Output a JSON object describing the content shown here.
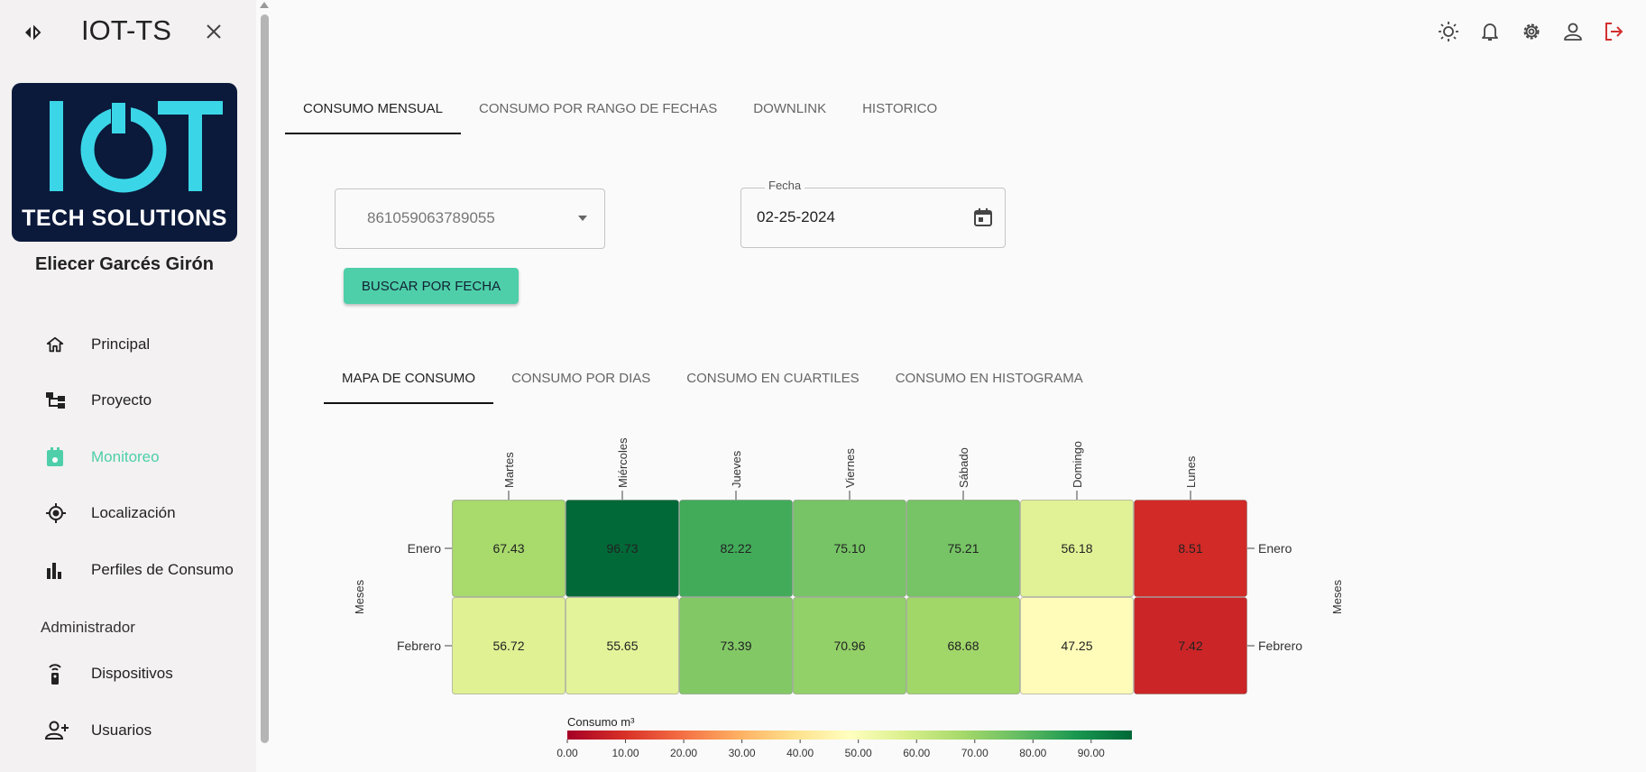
{
  "app": {
    "title": "IOT-TS"
  },
  "logo": {
    "tagline": "TECH SOLUTIONS"
  },
  "user": {
    "name": "Eliecer Garcés Girón"
  },
  "sidebar": {
    "items": [
      {
        "label": "Principal",
        "icon": "home-icon"
      },
      {
        "label": "Proyecto",
        "icon": "project-tree-icon"
      },
      {
        "label": "Monitoreo",
        "icon": "monitor-calendar-icon",
        "active": true
      },
      {
        "label": "Localización",
        "icon": "location-target-icon"
      },
      {
        "label": "Perfiles de Consumo",
        "icon": "bar-chart-icon"
      }
    ],
    "section_label": "Administrador",
    "admin_items": [
      {
        "label": "Dispositivos",
        "icon": "remote-device-icon"
      },
      {
        "label": "Usuarios",
        "icon": "add-user-icon"
      }
    ]
  },
  "topbar": {
    "icons": [
      "theme-sun-icon",
      "notifications-bell-icon",
      "settings-gear-icon",
      "account-person-icon",
      "logout-icon"
    ],
    "logout_color": "#d32f2f"
  },
  "main_tabs": [
    "CONSUMO MENSUAL",
    "CONSUMO POR RANGO DE FECHAS",
    "DOWNLINK",
    "HISTORICO"
  ],
  "main_tab_active": 0,
  "form": {
    "device_select_value": "861059063789055",
    "date_label": "Fecha",
    "date_value": "02-25-2024",
    "search_button": "BUSCAR POR FECHA"
  },
  "sub_tabs": [
    "MAPA DE CONSUMO",
    "CONSUMO POR DIAS",
    "CONSUMO EN CUARTILES",
    "CONSUMO EN HISTOGRAMA"
  ],
  "sub_tab_active": 0,
  "colors": {
    "accent": "#4ecfa9",
    "brand_navy": "#0b1a3b",
    "logo_cyan": "#3ad6e8"
  },
  "chart_data": {
    "type": "heatmap",
    "x_categories": [
      "Martes",
      "Miércoles",
      "Jueves",
      "Viernes",
      "Sábado",
      "Domingo",
      "Lunes"
    ],
    "y_categories": [
      "Enero",
      "Febrero"
    ],
    "ylabel": "Meses",
    "values": [
      [
        67.43,
        96.73,
        82.22,
        75.1,
        75.21,
        56.18,
        8.51
      ],
      [
        56.72,
        55.65,
        73.39,
        70.96,
        68.68,
        47.25,
        7.42
      ]
    ],
    "colorbar": {
      "title": "Consumo m³",
      "range": [
        0,
        97
      ],
      "ticks": [
        "0.00",
        "10.00",
        "20.00",
        "30.00",
        "40.00",
        "50.00",
        "60.00",
        "70.00",
        "80.00",
        "90.00"
      ],
      "colorscale": "RdYlGn"
    }
  }
}
